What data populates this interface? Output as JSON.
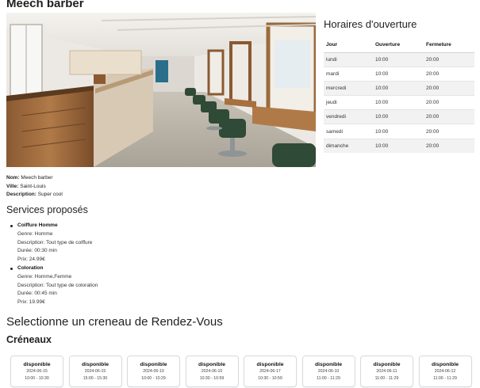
{
  "shop": {
    "name": "Meech barber",
    "photo_alt": "barbershop-interior-photo",
    "info": {
      "name_label": "Nom:",
      "name_value": "Meech barber",
      "city_label": "Ville:",
      "city_value": "Saint-Louis",
      "desc_label": "Description:",
      "desc_value": "Super cool"
    }
  },
  "hours": {
    "title": "Horaires d'ouverture",
    "columns": [
      "Jour",
      "Ouverture",
      "Fermeture"
    ],
    "rows": [
      {
        "day": "lundi",
        "open": "10:00",
        "close": "20:00"
      },
      {
        "day": "mardi",
        "open": "10:00",
        "close": "20:00"
      },
      {
        "day": "mercredi",
        "open": "10:00",
        "close": "20:00"
      },
      {
        "day": "jeudi",
        "open": "10:00",
        "close": "20:00"
      },
      {
        "day": "vendredi",
        "open": "10:00",
        "close": "20:00"
      },
      {
        "day": "samedi",
        "open": "10:00",
        "close": "20:00"
      },
      {
        "day": "dimanche",
        "open": "10:00",
        "close": "20:00"
      }
    ]
  },
  "services": {
    "title": "Services proposés",
    "items": [
      {
        "name": "Coiffure Homme",
        "genre": "Genre: Homme",
        "description": "Description: Tout type de coiffure",
        "duration": "Durée: 00:30 min",
        "price": "Prix: 24.99€"
      },
      {
        "name": "Coloration",
        "genre": "Genre: Homme,Femme",
        "description": "Description: Tout type de coloration",
        "duration": "Durée: 00:45 min",
        "price": "Prix: 19.99€"
      }
    ]
  },
  "booking": {
    "title": "Selectionne un creneau de Rendez-Vous",
    "slots_title": "Créneaux",
    "slots": [
      {
        "status": "disponible",
        "date": "2024-06-15",
        "time": "10:00 - 10:30"
      },
      {
        "status": "disponible",
        "date": "2024-06-15",
        "time": "15:00 - 15:30"
      },
      {
        "status": "disponible",
        "date": "2024-06-10",
        "time": "10:00 - 10:29"
      },
      {
        "status": "disponible",
        "date": "2024-06-10",
        "time": "10:30 - 10:59"
      },
      {
        "status": "disponible",
        "date": "2024-06-17",
        "time": "10:30 - 10:59"
      },
      {
        "status": "disponible",
        "date": "2024-06-10",
        "time": "11:00 - 11:29"
      },
      {
        "status": "disponible",
        "date": "2024-06-11",
        "time": "11:00 - 11:29"
      },
      {
        "status": "disponible",
        "date": "2024-06-12",
        "time": "11:00 - 11:29"
      }
    ]
  }
}
